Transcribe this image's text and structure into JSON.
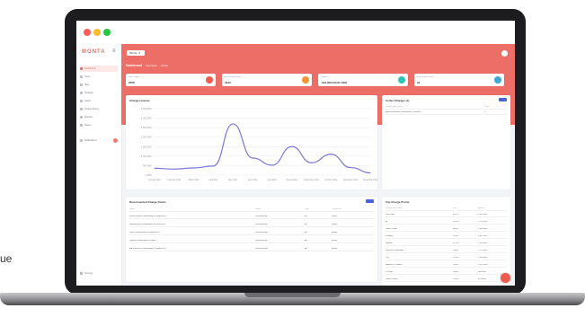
{
  "side_text": "ue",
  "app": {
    "logo": "MONTA",
    "colors": {
      "brand": "#ed6e66",
      "accent": "#4a63d9",
      "chart_line": "#7b77d9"
    }
  },
  "window_controls": [
    {
      "name": "close",
      "color": "#ff5f57"
    },
    {
      "name": "minimize",
      "color": "#febc2e"
    },
    {
      "name": "zoom",
      "color": "#28c840"
    }
  ],
  "sidebar": {
    "items": [
      {
        "label": "Dashboard",
        "active": true
      },
      {
        "label": "Users",
        "active": false
      },
      {
        "label": "Sites",
        "active": false
      },
      {
        "label": "Chargers",
        "active": false
      },
      {
        "label": "Cards",
        "active": false
      },
      {
        "label": "Charge Points",
        "active": false
      },
      {
        "label": "Reports",
        "active": false
      },
      {
        "label": "Teams",
        "active": false
      },
      {
        "label": "Notifications",
        "active": false,
        "badge": true
      }
    ],
    "bottom_label": "Settings"
  },
  "header": {
    "dropdown_value": "Monta",
    "breadcrumb": {
      "title": "Dashboard",
      "items": [
        "Overview",
        "Home"
      ]
    }
  },
  "stats": [
    {
      "label": "Total Charges",
      "value": "2058",
      "icon_color": "#ef5b4d"
    },
    {
      "label": "Active Charge Points",
      "value": "3433",
      "icon_color": "#f79533"
    },
    {
      "label": "Revenue",
      "value": "-193,356,540.61 DKK",
      "icon_color": "#2ec4b6"
    },
    {
      "label": "Active Subscriptions",
      "value": "34",
      "icon_color": "#3fa7d6"
    }
  ],
  "charge_revenue": {
    "title": "Charge revenue"
  },
  "active_charges": {
    "title": "Active Charges (1)",
    "columns": [
      "Charge point name",
      "Start"
    ],
    "rows": [
      [
        "Anders Hansens Ladestander i Gårdslev",
        "5"
      ]
    ]
  },
  "disconnected": {
    "title": "Disconnected Charge Points",
    "columns": [
      "Name",
      "Status",
      "Type",
      "Connected"
    ],
    "rows": [
      [
        "Kallissa Elbas Ladestander til Gårdslev 01",
        "Disconnected",
        "AC",
        "Never"
      ],
      [
        "Efferenkaster Ladestander til Gårdslev 02",
        "Disconnected",
        "AC",
        "Never"
      ],
      [
        "Jepes Ladestander til Gårdslev 03",
        "Disconnected",
        "AC",
        "Never"
      ],
      [
        "Lugas83 Ladestager Fra Hjem",
        "Disconnected",
        "AC",
        "Never"
      ],
      [
        "Anne Mortens Ladestander til Gårdslev 02",
        "Disconnected",
        "AC",
        "Never"
      ]
    ]
  },
  "top_charge_points": {
    "title": "Top Charge Points",
    "columns": [
      "Charge point name",
      "kWh",
      "Amount"
    ],
    "rows": [
      [
        "Pay Public",
        "482 kr",
        "2,819 kWh"
      ],
      [
        "Hf",
        "510 kr",
        "2,211 kWh"
      ],
      [
        "Jonas Testlift",
        "488 kr",
        "1,894 kWh"
      ],
      [
        "af tabby",
        "383 kr",
        "1,622 kWh"
      ],
      [
        "Baldwin",
        "321 kr",
        "1,404 kWh"
      ],
      [
        "Michaels Ladestager",
        "296 kr",
        "1,210 kWh"
      ],
      [
        "Pay",
        "274 kr",
        "1,098 kWh"
      ],
      [
        "Hodson 10 Laneris",
        "255 kr",
        "1,012 kWh"
      ],
      [
        "HT Hub",
        "244 kr",
        "988 kWh"
      ],
      [
        "Jonas Testlift 2",
        "219 kr",
        "874 kWh"
      ]
    ]
  },
  "chart_data": {
    "type": "line",
    "x": [
      "January 2021",
      "February 2021",
      "March 2021",
      "April 2021",
      "May 2021",
      "June 2021",
      "July 2021",
      "August 2021",
      "September 2021",
      "October 2021",
      "November 2021",
      "December 2021"
    ],
    "series": [
      {
        "values": [
          360,
          320,
          380,
          480,
          2700,
          900,
          520,
          1500,
          650,
          1100,
          400,
          120
        ]
      }
    ],
    "y_ticks": [
      "3,500 DKK",
      "3,000 DKK",
      "2,500 DKK",
      "2,000 DKK",
      "1,500 DKK",
      "1,000 DKK",
      "500 DKK",
      "0 DKK"
    ],
    "ylim": [
      0,
      3500
    ],
    "grid": true
  }
}
